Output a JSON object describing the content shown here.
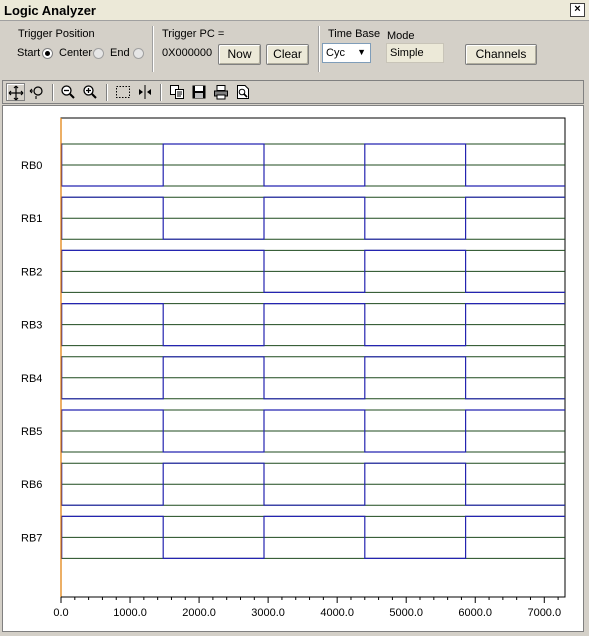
{
  "window": {
    "title": "Logic Analyzer",
    "close_glyph": "×"
  },
  "trigger_position": {
    "label": "Trigger Position",
    "options": [
      "Start",
      "Center",
      "End"
    ],
    "selected": "Start"
  },
  "trigger_pc": {
    "label": "Trigger PC =",
    "value": "0X000000",
    "now_label": "Now",
    "clear_label": "Clear"
  },
  "time_base": {
    "label": "Time Base",
    "value": "Cyc"
  },
  "mode": {
    "label": "Mode",
    "value": "Simple"
  },
  "channels_label": "Channels",
  "toolbar_icons": [
    "move-icon",
    "zoom-select-icon",
    "zoom-out-icon",
    "zoom-in-icon",
    "select-region-icon",
    "cursor-marker-icon",
    "copy-icon",
    "save-icon",
    "print-icon",
    "print-preview-icon"
  ],
  "colors": {
    "signal": "#2424b0",
    "grid": "#1d4a1d",
    "trigger": "#e07a00"
  },
  "chart_data": {
    "type": "line",
    "xlim": [
      0,
      7300
    ],
    "x_ticks": [
      "0.0",
      "1000.0",
      "2000.0",
      "3000.0",
      "4000.0",
      "5000.0",
      "6000.0",
      "7000.0"
    ],
    "trigger_x": 0,
    "series": [
      {
        "name": "RB0",
        "points": [
          [
            0,
            1
          ],
          [
            10,
            1
          ],
          [
            10,
            0
          ],
          [
            1480,
            0
          ],
          [
            1480,
            1
          ],
          [
            2940,
            1
          ],
          [
            2940,
            0
          ],
          [
            4400,
            0
          ],
          [
            4400,
            1
          ],
          [
            5860,
            1
          ],
          [
            5860,
            0
          ],
          [
            7300,
            0
          ]
        ]
      },
      {
        "name": "RB1",
        "points": [
          [
            0,
            0
          ],
          [
            10,
            0
          ],
          [
            10,
            1
          ],
          [
            1480,
            1
          ],
          [
            1480,
            0
          ],
          [
            2940,
            0
          ],
          [
            2940,
            1
          ],
          [
            4400,
            1
          ],
          [
            4400,
            0
          ],
          [
            5860,
            0
          ],
          [
            5860,
            1
          ],
          [
            7300,
            1
          ]
        ]
      },
      {
        "name": "RB2",
        "points": [
          [
            0,
            0
          ],
          [
            10,
            0
          ],
          [
            10,
            1
          ],
          [
            1480,
            1
          ],
          [
            1480,
            1
          ],
          [
            2940,
            1
          ],
          [
            2940,
            0
          ],
          [
            4400,
            0
          ],
          [
            4400,
            1
          ],
          [
            5860,
            1
          ],
          [
            5860,
            0
          ],
          [
            7300,
            0
          ]
        ]
      },
      {
        "name": "RB3",
        "points": [
          [
            0,
            0
          ],
          [
            10,
            0
          ],
          [
            10,
            1
          ],
          [
            1480,
            1
          ],
          [
            1480,
            0
          ],
          [
            2940,
            0
          ],
          [
            2940,
            1
          ],
          [
            4400,
            1
          ],
          [
            4400,
            0
          ],
          [
            5860,
            0
          ],
          [
            5860,
            1
          ],
          [
            7300,
            1
          ]
        ]
      },
      {
        "name": "RB4",
        "points": [
          [
            0,
            1
          ],
          [
            10,
            1
          ],
          [
            10,
            0
          ],
          [
            1480,
            0
          ],
          [
            1480,
            1
          ],
          [
            2940,
            1
          ],
          [
            2940,
            0
          ],
          [
            4400,
            0
          ],
          [
            4400,
            1
          ],
          [
            5860,
            1
          ],
          [
            5860,
            0
          ],
          [
            7300,
            0
          ]
        ]
      },
      {
        "name": "RB5",
        "points": [
          [
            0,
            0
          ],
          [
            10,
            0
          ],
          [
            10,
            1
          ],
          [
            1480,
            1
          ],
          [
            1480,
            0
          ],
          [
            2940,
            0
          ],
          [
            2940,
            1
          ],
          [
            4400,
            1
          ],
          [
            4400,
            0
          ],
          [
            5860,
            0
          ],
          [
            5860,
            1
          ],
          [
            7300,
            1
          ]
        ]
      },
      {
        "name": "RB6",
        "points": [
          [
            0,
            1
          ],
          [
            10,
            1
          ],
          [
            10,
            0
          ],
          [
            1480,
            0
          ],
          [
            1480,
            1
          ],
          [
            2940,
            1
          ],
          [
            2940,
            0
          ],
          [
            4400,
            0
          ],
          [
            4400,
            1
          ],
          [
            5860,
            1
          ],
          [
            5860,
            0
          ],
          [
            7300,
            0
          ]
        ]
      },
      {
        "name": "RB7",
        "points": [
          [
            0,
            0
          ],
          [
            10,
            0
          ],
          [
            10,
            1
          ],
          [
            1480,
            1
          ],
          [
            1480,
            0
          ],
          [
            2940,
            0
          ],
          [
            2940,
            1
          ],
          [
            4400,
            1
          ],
          [
            4400,
            0
          ],
          [
            5860,
            0
          ],
          [
            5860,
            1
          ],
          [
            7300,
            1
          ]
        ]
      }
    ]
  }
}
